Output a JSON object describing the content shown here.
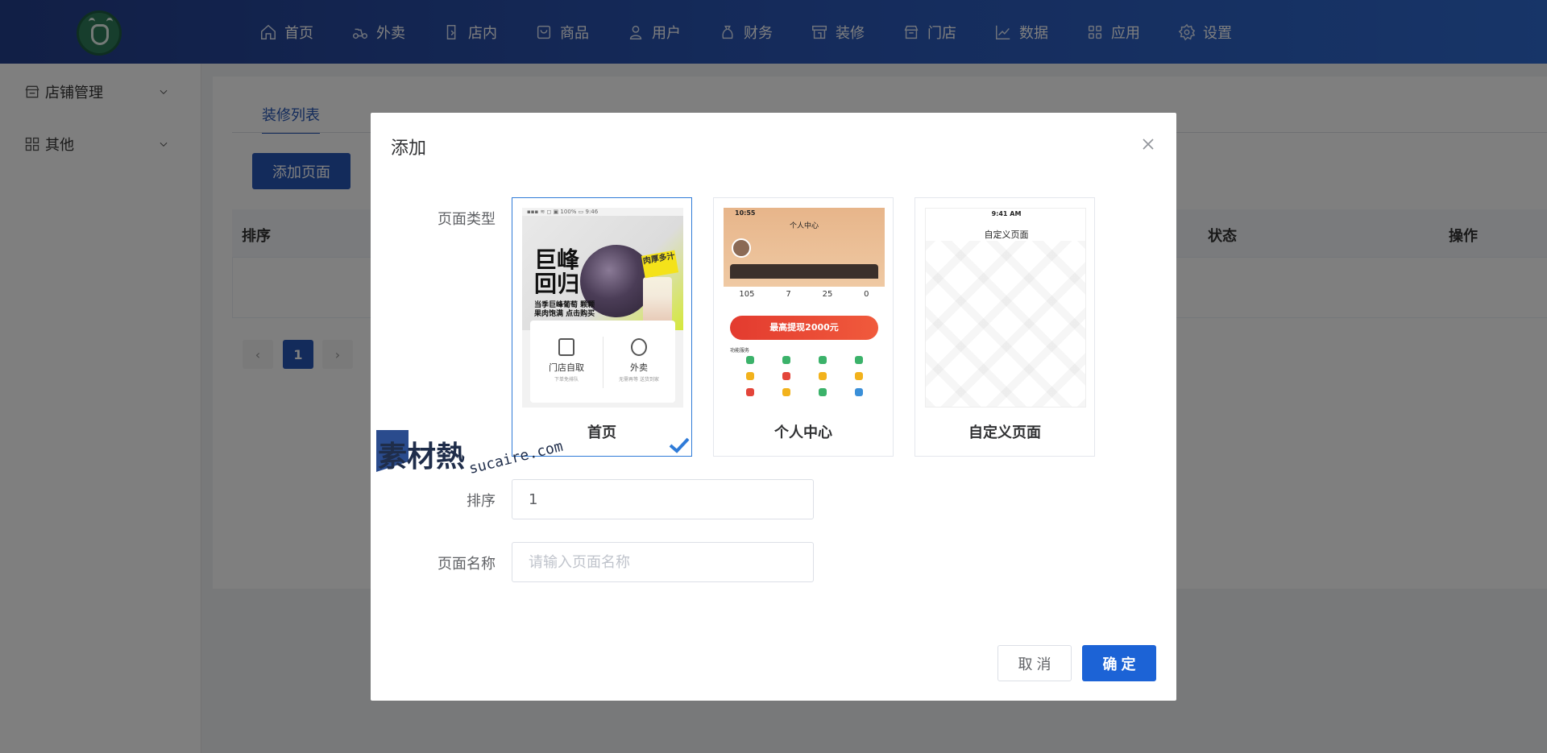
{
  "app": {
    "nav": [
      {
        "label": "首页",
        "icon": "home-icon"
      },
      {
        "label": "外卖",
        "icon": "scooter-icon"
      },
      {
        "label": "店内",
        "icon": "store-entry-icon"
      },
      {
        "label": "商品",
        "icon": "product-icon"
      },
      {
        "label": "用户",
        "icon": "user-icon"
      },
      {
        "label": "财务",
        "icon": "money-bag-icon"
      },
      {
        "label": "装修",
        "icon": "decoration-icon"
      },
      {
        "label": "门店",
        "icon": "shop-icon"
      },
      {
        "label": "数据",
        "icon": "chart-line-icon"
      },
      {
        "label": "应用",
        "icon": "apps-grid-icon"
      },
      {
        "label": "设置",
        "icon": "gear-icon"
      }
    ]
  },
  "sidebar": {
    "items": [
      {
        "label": "店铺管理",
        "icon": "store-icon"
      },
      {
        "label": "其他",
        "icon": "grid-icon"
      }
    ]
  },
  "main": {
    "tab": "装修列表",
    "add_button": "添加页面",
    "columns": [
      "排序",
      "状态",
      "操作"
    ],
    "pagination": {
      "current": "1"
    }
  },
  "dialog": {
    "title": "添加",
    "labels": {
      "page_type": "页面类型",
      "sort": "排序",
      "page_name": "页面名称"
    },
    "cards": [
      {
        "label": "首页",
        "selected": true
      },
      {
        "label": "个人中心",
        "selected": false
      },
      {
        "label": "自定义页面",
        "selected": false
      }
    ],
    "sort_value": "1",
    "name_placeholder": "请输入页面名称",
    "cancel": "取 消",
    "confirm": "确 定"
  },
  "thumbs": {
    "home": {
      "status": "▪▪▪ ≋ ◻ ▣      100% ▭ 9:46",
      "hero_title": "巨峰回归",
      "hero_sub": "当季巨峰葡萄 颗颗果肉饱满 点击购买",
      "badge": "肉厚多汁",
      "pickup": "门店自取",
      "pickup_sub": "下单免排队",
      "delivery": "外卖",
      "delivery_sub": "无需再等 送货到家"
    },
    "profile": {
      "time": "10:55",
      "title": "个人中心",
      "stats": [
        "105",
        "7",
        "25",
        "0"
      ],
      "banner": "最高提现2000元",
      "service": "功能服务"
    },
    "custom": {
      "time": "9:41 AM",
      "title": "自定义页面"
    }
  },
  "watermark": {
    "zh": "素材熱",
    "en": "sucaire.com"
  },
  "colors": {
    "primary": "#2756b6",
    "confirm": "#1c63d6",
    "nav_start": "#233e8c",
    "nav_end": "#2f6ad0"
  }
}
